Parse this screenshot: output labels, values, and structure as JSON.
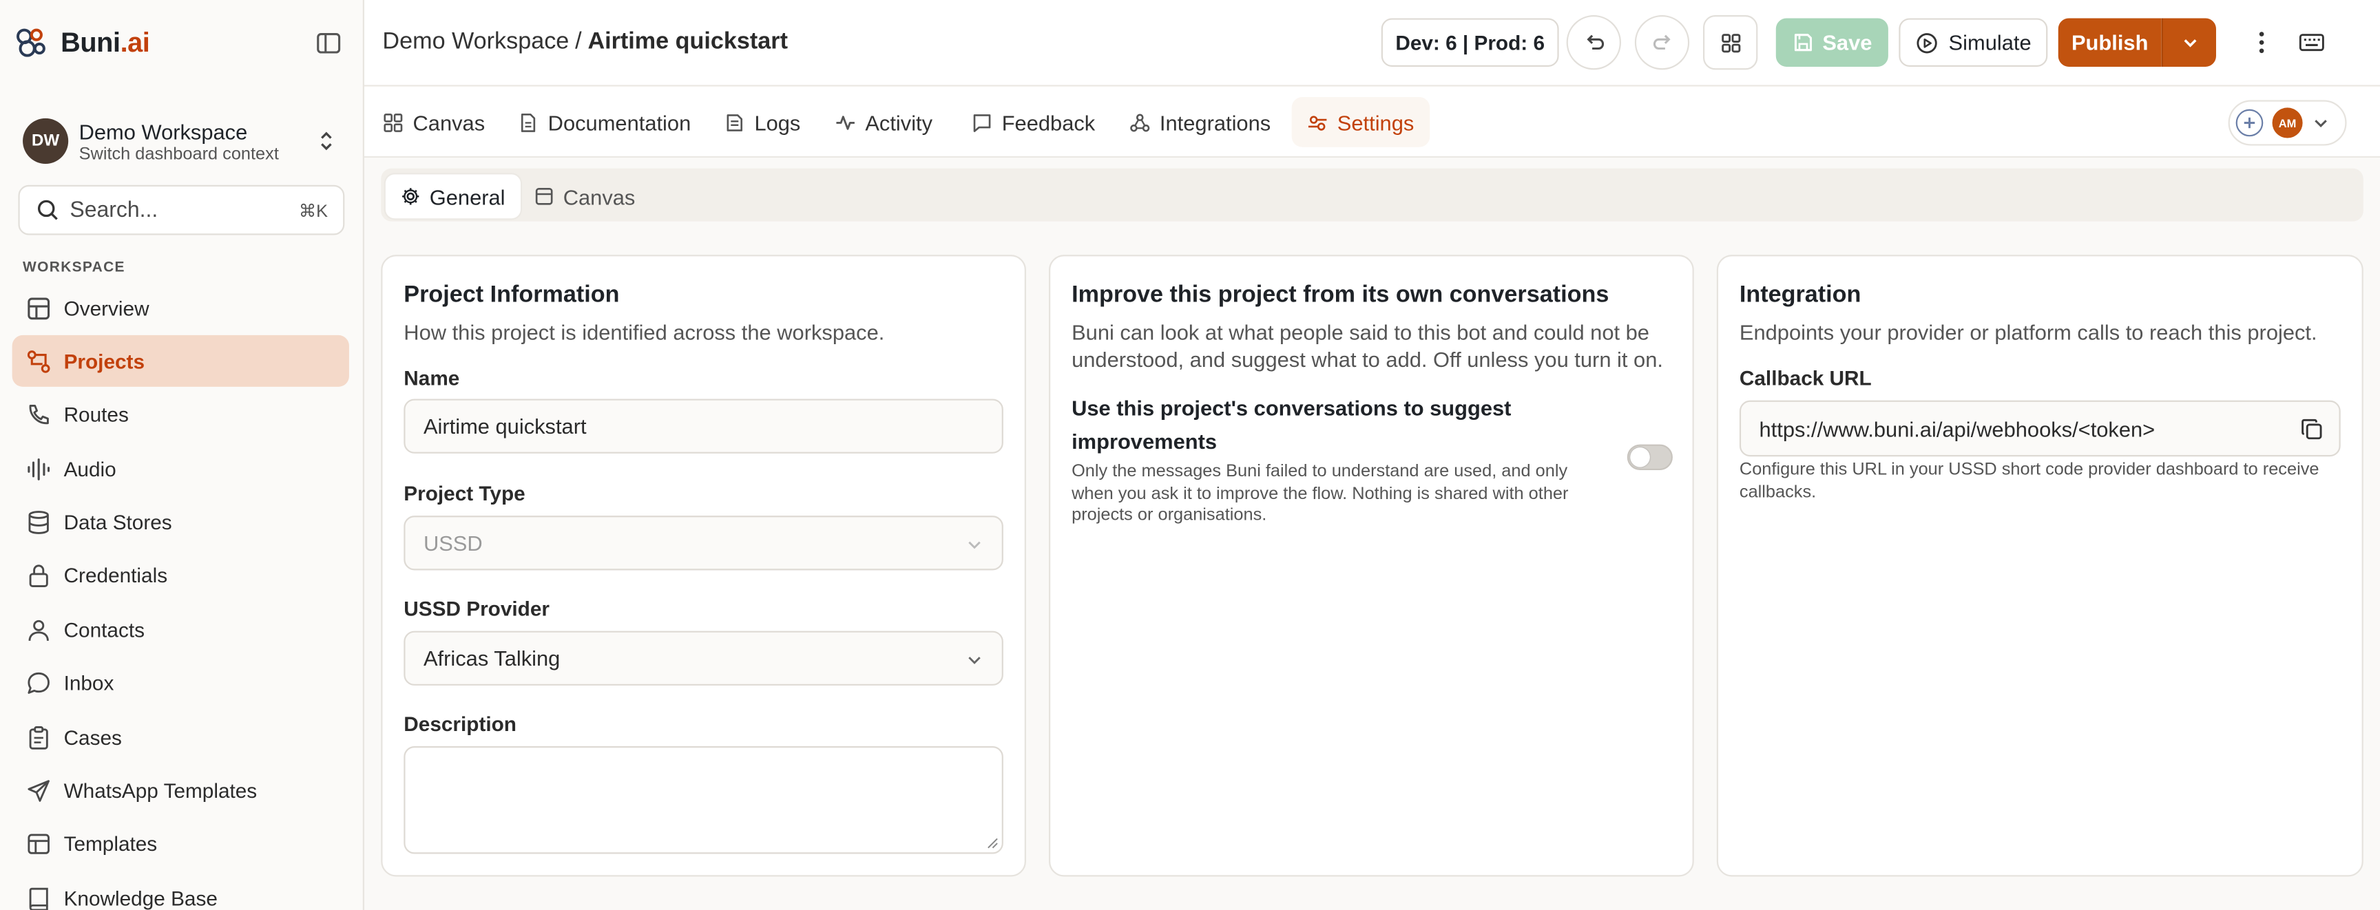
{
  "brand": {
    "name_main": "Buni",
    "name_accent": ".ai"
  },
  "workspace": {
    "initials": "DW",
    "name": "Demo Workspace",
    "subtitle": "Switch dashboard context"
  },
  "search": {
    "placeholder": "Search...",
    "shortcut": "⌘K"
  },
  "sidebar": {
    "section_label": "WORKSPACE",
    "items": [
      {
        "label": "Overview",
        "icon": "grid-icon",
        "active": false
      },
      {
        "label": "Projects",
        "icon": "projects-icon",
        "active": true
      },
      {
        "label": "Routes",
        "icon": "phone-icon",
        "active": false
      },
      {
        "label": "Audio",
        "icon": "audio-wave-icon",
        "active": false
      },
      {
        "label": "Data Stores",
        "icon": "database-icon",
        "active": false
      },
      {
        "label": "Credentials",
        "icon": "lock-icon",
        "active": false
      },
      {
        "label": "Contacts",
        "icon": "user-icon",
        "active": false
      },
      {
        "label": "Inbox",
        "icon": "chat-bubble-icon",
        "active": false
      },
      {
        "label": "Cases",
        "icon": "clipboard-icon",
        "active": false
      },
      {
        "label": "WhatsApp Templates",
        "icon": "send-icon",
        "active": false
      },
      {
        "label": "Templates",
        "icon": "template-icon",
        "active": false
      },
      {
        "label": "Knowledge Base",
        "icon": "book-icon",
        "active": false
      }
    ]
  },
  "header": {
    "workspace_crumb": "Demo Workspace",
    "separator": "/",
    "project_crumb": "Airtime quickstart",
    "env_status": "Dev: 6 | Prod: 6",
    "save_label": "Save",
    "simulate_label": "Simulate",
    "publish_label": "Publish"
  },
  "tabs": [
    {
      "label": "Canvas",
      "icon": "grid-icon",
      "active": false
    },
    {
      "label": "Documentation",
      "icon": "document-icon",
      "active": false
    },
    {
      "label": "Logs",
      "icon": "logs-icon",
      "active": false
    },
    {
      "label": "Activity",
      "icon": "activity-icon",
      "active": false
    },
    {
      "label": "Feedback",
      "icon": "message-icon",
      "active": false
    },
    {
      "label": "Integrations",
      "icon": "webhook-icon",
      "active": false
    },
    {
      "label": "Settings",
      "icon": "settings-sliders-icon",
      "active": true
    }
  ],
  "presence": {
    "user_initials": "AM"
  },
  "subtabs": [
    {
      "label": "General",
      "icon": "gear-icon",
      "active": true
    },
    {
      "label": "Canvas",
      "icon": "canvas-icon",
      "active": false
    }
  ],
  "project_info": {
    "title": "Project Information",
    "subtitle": "How this project is identified across the workspace.",
    "name_label": "Name",
    "name_value": "Airtime quickstart",
    "type_label": "Project Type",
    "type_value": "USSD",
    "provider_label": "USSD Provider",
    "provider_value": "Africas Talking",
    "description_label": "Description",
    "description_value": ""
  },
  "improve": {
    "title": "Improve this project from its own conversations",
    "subtitle": "Buni can look at what people said to this bot and could not be understood, and suggest what to add. Off unless you turn it on.",
    "toggle_title": "Use this project's conversations to suggest improvements",
    "toggle_help": "Only the messages Buni failed to understand are used, and only when you ask it to improve the flow. Nothing is shared with other projects or organisations.",
    "toggle_on": false
  },
  "integration": {
    "title": "Integration",
    "subtitle": "Endpoints your provider or platform calls to reach this project.",
    "callback_label": "Callback URL",
    "callback_value": "https://www.buni.ai/api/webhooks/<token>",
    "callback_help": "Configure this URL in your USSD short code provider dashboard to receive callbacks."
  },
  "colors": {
    "accent": "#c2410c",
    "publish": "#c2530f",
    "save_disabled": "#a8d5b8",
    "active_nav_bg": "#f4d9c9"
  }
}
